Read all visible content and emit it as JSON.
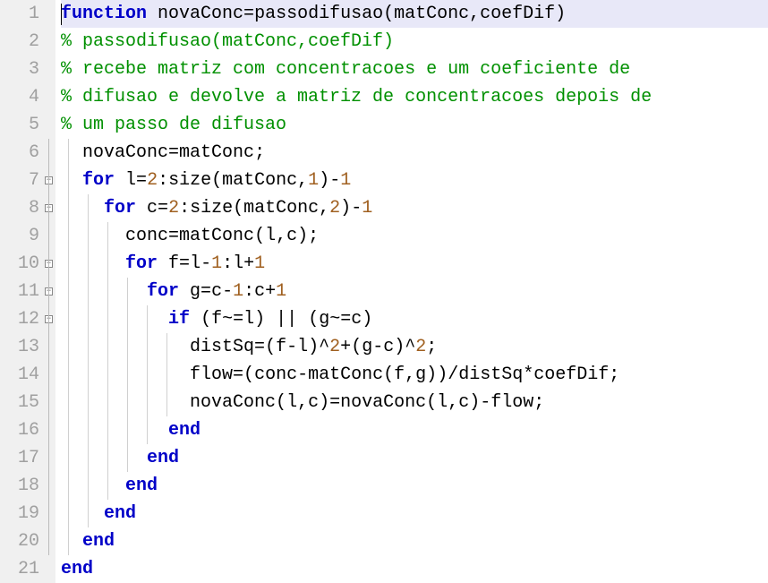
{
  "editor": {
    "filename_hint": "passodifusao.m",
    "highlighted_line": 1,
    "lines": [
      {
        "n": 1,
        "fold": "none",
        "guides": [],
        "cursor_col": 0,
        "tokens": [
          {
            "cls": "kw",
            "t": "function"
          },
          {
            "cls": "txt",
            "t": " novaConc"
          },
          {
            "cls": "op",
            "t": "="
          },
          {
            "cls": "txt",
            "t": "passodifusao"
          },
          {
            "cls": "op",
            "t": "("
          },
          {
            "cls": "txt",
            "t": "matConc"
          },
          {
            "cls": "op",
            "t": ","
          },
          {
            "cls": "txt",
            "t": "coefDif"
          },
          {
            "cls": "op",
            "t": ")"
          }
        ]
      },
      {
        "n": 2,
        "fold": "none",
        "guides": [],
        "tokens": [
          {
            "cls": "cmt",
            "t": "% passodifusao(matConc,coefDif)"
          }
        ]
      },
      {
        "n": 3,
        "fold": "none",
        "guides": [],
        "tokens": [
          {
            "cls": "cmt",
            "t": "% recebe matriz com concentracoes e um coeficiente de"
          }
        ]
      },
      {
        "n": 4,
        "fold": "none",
        "guides": [],
        "tokens": [
          {
            "cls": "cmt",
            "t": "% difusao e devolve a matriz de concentracoes depois de"
          }
        ]
      },
      {
        "n": 5,
        "fold": "none",
        "guides": [],
        "tokens": [
          {
            "cls": "cmt",
            "t": "% um passo de difusao"
          }
        ]
      },
      {
        "n": 6,
        "fold": "bar",
        "guides": [
          1
        ],
        "tokens": [
          {
            "cls": "txt",
            "t": "  novaConc"
          },
          {
            "cls": "op",
            "t": "="
          },
          {
            "cls": "txt",
            "t": "matConc"
          },
          {
            "cls": "op",
            "t": ";"
          }
        ]
      },
      {
        "n": 7,
        "fold": "open",
        "guides": [
          1
        ],
        "tokens": [
          {
            "cls": "txt",
            "t": "  "
          },
          {
            "cls": "kw",
            "t": "for"
          },
          {
            "cls": "txt",
            "t": " l"
          },
          {
            "cls": "op",
            "t": "="
          },
          {
            "cls": "num",
            "t": "2"
          },
          {
            "cls": "op",
            "t": ":"
          },
          {
            "cls": "txt",
            "t": "size"
          },
          {
            "cls": "op",
            "t": "("
          },
          {
            "cls": "txt",
            "t": "matConc"
          },
          {
            "cls": "op",
            "t": ","
          },
          {
            "cls": "num",
            "t": "1"
          },
          {
            "cls": "op",
            "t": ")"
          },
          {
            "cls": "op",
            "t": "-"
          },
          {
            "cls": "num",
            "t": "1"
          }
        ]
      },
      {
        "n": 8,
        "fold": "open",
        "guides": [
          1,
          2
        ],
        "tokens": [
          {
            "cls": "txt",
            "t": "    "
          },
          {
            "cls": "kw",
            "t": "for"
          },
          {
            "cls": "txt",
            "t": " c"
          },
          {
            "cls": "op",
            "t": "="
          },
          {
            "cls": "num",
            "t": "2"
          },
          {
            "cls": "op",
            "t": ":"
          },
          {
            "cls": "txt",
            "t": "size"
          },
          {
            "cls": "op",
            "t": "("
          },
          {
            "cls": "txt",
            "t": "matConc"
          },
          {
            "cls": "op",
            "t": ","
          },
          {
            "cls": "num",
            "t": "2"
          },
          {
            "cls": "op",
            "t": ")"
          },
          {
            "cls": "op",
            "t": "-"
          },
          {
            "cls": "num",
            "t": "1"
          }
        ]
      },
      {
        "n": 9,
        "fold": "bar",
        "guides": [
          1,
          2,
          3
        ],
        "tokens": [
          {
            "cls": "txt",
            "t": "      conc"
          },
          {
            "cls": "op",
            "t": "="
          },
          {
            "cls": "txt",
            "t": "matConc"
          },
          {
            "cls": "op",
            "t": "("
          },
          {
            "cls": "txt",
            "t": "l"
          },
          {
            "cls": "op",
            "t": ","
          },
          {
            "cls": "txt",
            "t": "c"
          },
          {
            "cls": "op",
            "t": ")"
          },
          {
            "cls": "op",
            "t": ";"
          }
        ]
      },
      {
        "n": 10,
        "fold": "open",
        "guides": [
          1,
          2,
          3
        ],
        "tokens": [
          {
            "cls": "txt",
            "t": "      "
          },
          {
            "cls": "kw",
            "t": "for"
          },
          {
            "cls": "txt",
            "t": " f"
          },
          {
            "cls": "op",
            "t": "="
          },
          {
            "cls": "txt",
            "t": "l"
          },
          {
            "cls": "op",
            "t": "-"
          },
          {
            "cls": "num",
            "t": "1"
          },
          {
            "cls": "op",
            "t": ":"
          },
          {
            "cls": "txt",
            "t": "l"
          },
          {
            "cls": "op",
            "t": "+"
          },
          {
            "cls": "num",
            "t": "1"
          }
        ]
      },
      {
        "n": 11,
        "fold": "open",
        "guides": [
          1,
          2,
          3,
          4
        ],
        "tokens": [
          {
            "cls": "txt",
            "t": "        "
          },
          {
            "cls": "kw",
            "t": "for"
          },
          {
            "cls": "txt",
            "t": " g"
          },
          {
            "cls": "op",
            "t": "="
          },
          {
            "cls": "txt",
            "t": "c"
          },
          {
            "cls": "op",
            "t": "-"
          },
          {
            "cls": "num",
            "t": "1"
          },
          {
            "cls": "op",
            "t": ":"
          },
          {
            "cls": "txt",
            "t": "c"
          },
          {
            "cls": "op",
            "t": "+"
          },
          {
            "cls": "num",
            "t": "1"
          }
        ]
      },
      {
        "n": 12,
        "fold": "open",
        "guides": [
          1,
          2,
          3,
          4,
          5
        ],
        "tokens": [
          {
            "cls": "txt",
            "t": "          "
          },
          {
            "cls": "kw",
            "t": "if"
          },
          {
            "cls": "txt",
            "t": " "
          },
          {
            "cls": "op",
            "t": "("
          },
          {
            "cls": "txt",
            "t": "f"
          },
          {
            "cls": "op",
            "t": "~="
          },
          {
            "cls": "txt",
            "t": "l"
          },
          {
            "cls": "op",
            "t": ")"
          },
          {
            "cls": "txt",
            "t": " "
          },
          {
            "cls": "op",
            "t": "||"
          },
          {
            "cls": "txt",
            "t": " "
          },
          {
            "cls": "op",
            "t": "("
          },
          {
            "cls": "txt",
            "t": "g"
          },
          {
            "cls": "op",
            "t": "~="
          },
          {
            "cls": "txt",
            "t": "c"
          },
          {
            "cls": "op",
            "t": ")"
          }
        ]
      },
      {
        "n": 13,
        "fold": "bar",
        "guides": [
          1,
          2,
          3,
          4,
          5,
          6
        ],
        "tokens": [
          {
            "cls": "txt",
            "t": "            distSq"
          },
          {
            "cls": "op",
            "t": "="
          },
          {
            "cls": "op",
            "t": "("
          },
          {
            "cls": "txt",
            "t": "f"
          },
          {
            "cls": "op",
            "t": "-"
          },
          {
            "cls": "txt",
            "t": "l"
          },
          {
            "cls": "op",
            "t": ")"
          },
          {
            "cls": "op",
            "t": "^"
          },
          {
            "cls": "num",
            "t": "2"
          },
          {
            "cls": "op",
            "t": "+"
          },
          {
            "cls": "op",
            "t": "("
          },
          {
            "cls": "txt",
            "t": "g"
          },
          {
            "cls": "op",
            "t": "-"
          },
          {
            "cls": "txt",
            "t": "c"
          },
          {
            "cls": "op",
            "t": ")"
          },
          {
            "cls": "op",
            "t": "^"
          },
          {
            "cls": "num",
            "t": "2"
          },
          {
            "cls": "op",
            "t": ";"
          }
        ]
      },
      {
        "n": 14,
        "fold": "bar",
        "guides": [
          1,
          2,
          3,
          4,
          5,
          6
        ],
        "tokens": [
          {
            "cls": "txt",
            "t": "            flow"
          },
          {
            "cls": "op",
            "t": "="
          },
          {
            "cls": "op",
            "t": "("
          },
          {
            "cls": "txt",
            "t": "conc"
          },
          {
            "cls": "op",
            "t": "-"
          },
          {
            "cls": "txt",
            "t": "matConc"
          },
          {
            "cls": "op",
            "t": "("
          },
          {
            "cls": "txt",
            "t": "f"
          },
          {
            "cls": "op",
            "t": ","
          },
          {
            "cls": "txt",
            "t": "g"
          },
          {
            "cls": "op",
            "t": ")"
          },
          {
            "cls": "op",
            "t": ")"
          },
          {
            "cls": "op",
            "t": "/"
          },
          {
            "cls": "txt",
            "t": "distSq"
          },
          {
            "cls": "op",
            "t": "*"
          },
          {
            "cls": "txt",
            "t": "coefDif"
          },
          {
            "cls": "op",
            "t": ";"
          }
        ]
      },
      {
        "n": 15,
        "fold": "bar",
        "guides": [
          1,
          2,
          3,
          4,
          5,
          6
        ],
        "tokens": [
          {
            "cls": "txt",
            "t": "            novaConc"
          },
          {
            "cls": "op",
            "t": "("
          },
          {
            "cls": "txt",
            "t": "l"
          },
          {
            "cls": "op",
            "t": ","
          },
          {
            "cls": "txt",
            "t": "c"
          },
          {
            "cls": "op",
            "t": ")"
          },
          {
            "cls": "op",
            "t": "="
          },
          {
            "cls": "txt",
            "t": "novaConc"
          },
          {
            "cls": "op",
            "t": "("
          },
          {
            "cls": "txt",
            "t": "l"
          },
          {
            "cls": "op",
            "t": ","
          },
          {
            "cls": "txt",
            "t": "c"
          },
          {
            "cls": "op",
            "t": ")"
          },
          {
            "cls": "op",
            "t": "-"
          },
          {
            "cls": "txt",
            "t": "flow"
          },
          {
            "cls": "op",
            "t": ";"
          }
        ]
      },
      {
        "n": 16,
        "fold": "bar",
        "guides": [
          1,
          2,
          3,
          4,
          5
        ],
        "tokens": [
          {
            "cls": "txt",
            "t": "          "
          },
          {
            "cls": "kw",
            "t": "end"
          }
        ]
      },
      {
        "n": 17,
        "fold": "bar",
        "guides": [
          1,
          2,
          3,
          4
        ],
        "tokens": [
          {
            "cls": "txt",
            "t": "        "
          },
          {
            "cls": "kw",
            "t": "end"
          }
        ]
      },
      {
        "n": 18,
        "fold": "bar",
        "guides": [
          1,
          2,
          3
        ],
        "tokens": [
          {
            "cls": "txt",
            "t": "      "
          },
          {
            "cls": "kw",
            "t": "end"
          }
        ]
      },
      {
        "n": 19,
        "fold": "bar",
        "guides": [
          1,
          2
        ],
        "tokens": [
          {
            "cls": "txt",
            "t": "    "
          },
          {
            "cls": "kw",
            "t": "end"
          }
        ]
      },
      {
        "n": 20,
        "fold": "bar",
        "guides": [
          1
        ],
        "tokens": [
          {
            "cls": "txt",
            "t": "  "
          },
          {
            "cls": "kw",
            "t": "end"
          }
        ]
      },
      {
        "n": 21,
        "fold": "none",
        "guides": [],
        "tokens": [
          {
            "cls": "kw",
            "t": "end"
          }
        ]
      }
    ]
  },
  "colors": {
    "keyword": "#0000c8",
    "comment": "#009000",
    "number": "#a06020",
    "gutter_bg": "#f0f0f0",
    "gutter_fg": "#a0a0a0",
    "line_highlight": "#e8e8f8",
    "indent_guide": "#d0d0d0"
  }
}
